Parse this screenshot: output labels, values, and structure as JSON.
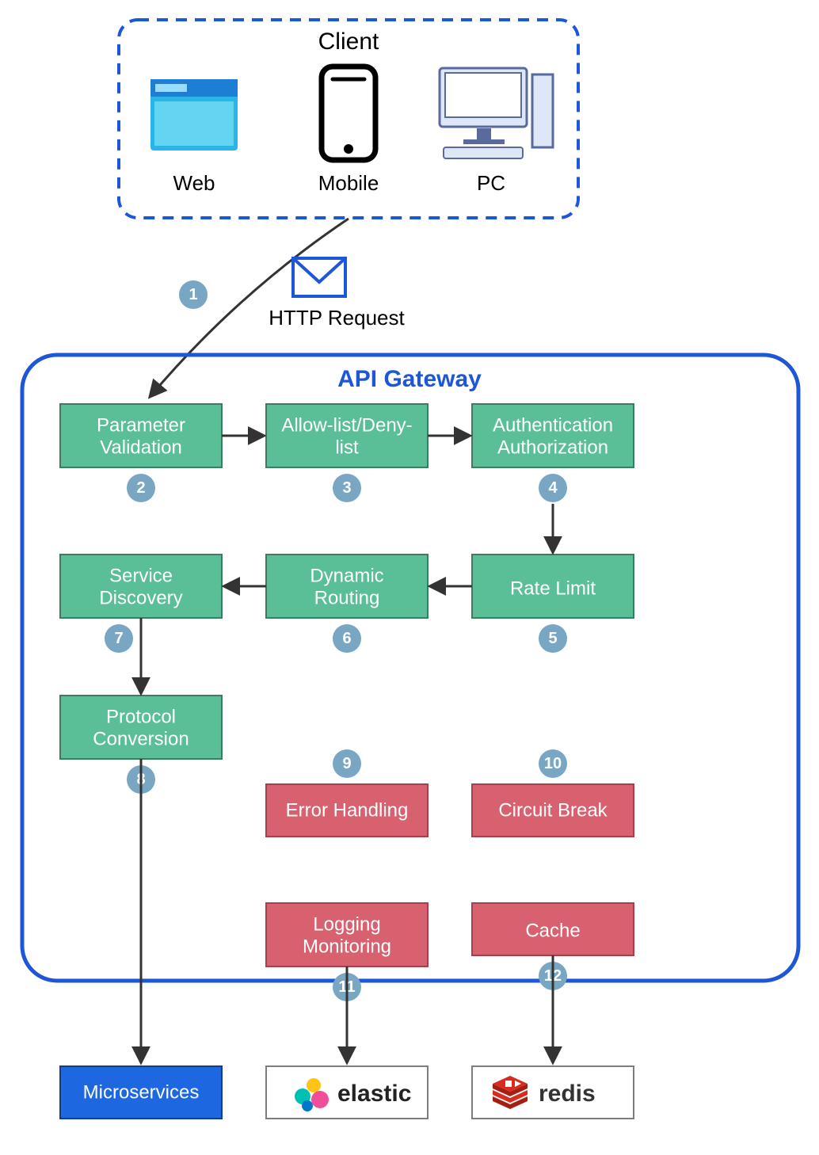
{
  "client": {
    "title": "Client",
    "items": [
      {
        "label": "Web",
        "icon": "web-browser-icon"
      },
      {
        "label": "Mobile",
        "icon": "smartphone-icon"
      },
      {
        "label": "PC",
        "icon": "desktop-pc-icon"
      }
    ]
  },
  "request_edge": {
    "step": "1",
    "label": "HTTP Request",
    "icon": "envelope-icon"
  },
  "gateway": {
    "title": "API Gateway",
    "steps": [
      {
        "n": "2",
        "label": "Parameter\nValidation",
        "color": "green"
      },
      {
        "n": "3",
        "label": "Allow-list/Deny-\nlist",
        "color": "green"
      },
      {
        "n": "4",
        "label": "Authentication\nAuthorization",
        "color": "green"
      },
      {
        "n": "5",
        "label": "Rate Limit",
        "color": "green"
      },
      {
        "n": "6",
        "label": "Dynamic\nRouting",
        "color": "green"
      },
      {
        "n": "7",
        "label": "Service\nDiscovery",
        "color": "green"
      },
      {
        "n": "8",
        "label": "Protocol\nConversion",
        "color": "green"
      },
      {
        "n": "9",
        "label": "Error Handling",
        "color": "red"
      },
      {
        "n": "10",
        "label": "Circuit Break",
        "color": "red"
      },
      {
        "n": "11",
        "label": "Logging\nMonitoring",
        "color": "red"
      },
      {
        "n": "12",
        "label": "Cache",
        "color": "red"
      }
    ],
    "flow_sequence": [
      "2",
      "3",
      "4",
      "5",
      "6",
      "7",
      "8"
    ]
  },
  "sinks": [
    {
      "from_step": "8",
      "label": "Microservices",
      "style": "blue",
      "icon": null
    },
    {
      "from_step": "11",
      "label": "elastic",
      "style": "white",
      "icon": "elastic-logo-icon"
    },
    {
      "from_step": "12",
      "label": "redis",
      "style": "white",
      "icon": "redis-logo-icon"
    }
  ]
}
